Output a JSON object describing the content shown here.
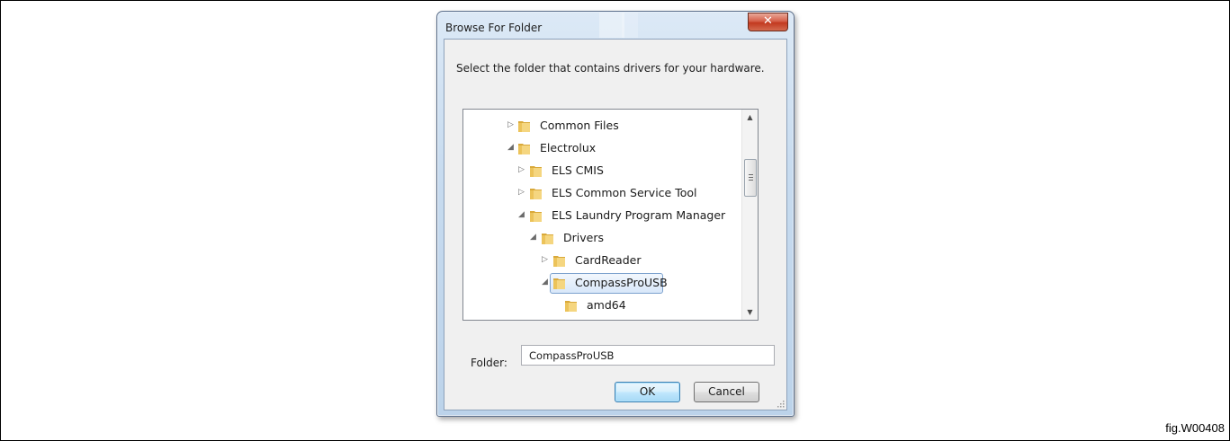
{
  "dialog": {
    "title": "Browse For Folder",
    "close_glyph": "✕",
    "instruction": "Select the folder that contains drivers for your hardware.",
    "folder_label": "Folder:",
    "folder_value": "CompassProUSB",
    "ok_label": "OK",
    "cancel_label": "Cancel"
  },
  "tree": {
    "items": [
      {
        "label": "Common Files",
        "expander": "collapsed"
      },
      {
        "label": "Electrolux",
        "expander": "expanded"
      },
      {
        "label": "ELS CMIS",
        "expander": "collapsed"
      },
      {
        "label": "ELS Common Service Tool",
        "expander": "collapsed"
      },
      {
        "label": "ELS Laundry Program Manager",
        "expander": "expanded"
      },
      {
        "label": "Drivers",
        "expander": "expanded"
      },
      {
        "label": "CardReader",
        "expander": "collapsed"
      },
      {
        "label": "CompassProUSB",
        "expander": "expanded",
        "selected": true
      },
      {
        "label": "amd64",
        "expander": "none"
      }
    ]
  },
  "caption": "fig.W00408",
  "colors": {
    "folder_light": "#f5d680",
    "folder_dark": "#d9a93a",
    "selection_border": "#7da2ce",
    "close_button": "#c2391f"
  }
}
